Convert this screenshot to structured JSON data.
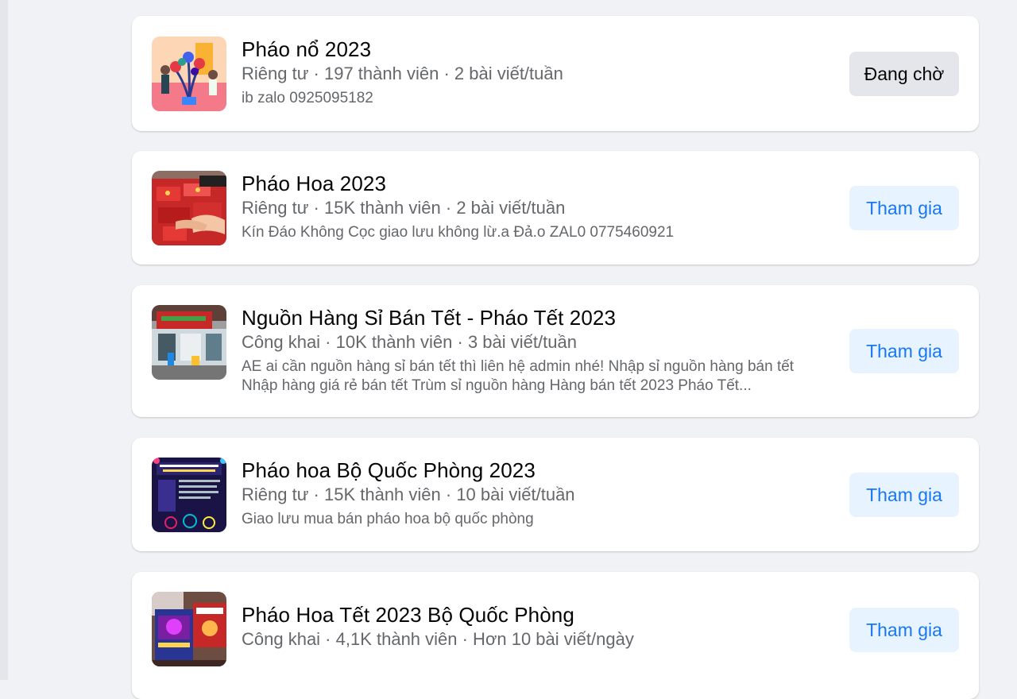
{
  "colors": {
    "page_background": "#f0f2f5",
    "card_background": "#ffffff",
    "primary_text": "#050505",
    "secondary_text": "#65676b",
    "join_button_bg": "#e7f3ff",
    "join_button_text": "#1877f2",
    "pending_button_bg": "#e4e6eb"
  },
  "groups": [
    {
      "name": "Pháo nổ 2023",
      "meta": "Riêng tư · 197 thành viên · 2 bài viết/tuần",
      "description": "ib zalo 0925095182",
      "button_label": "Đang chờ",
      "button_state": "pending",
      "thumbnail_icon": "flowers-illustration-image"
    },
    {
      "name": "Pháo Hoa 2023",
      "meta": "Riêng tư · 15K thành viên · 2 bài viết/tuần",
      "description": "Kín Đáo Không Cọc giao lưu không lừ.a Đả.o ZAL0 0775460921",
      "button_label": "Tham gia",
      "button_state": "join",
      "thumbnail_icon": "firework-boxes-photo"
    },
    {
      "name": "Nguồn Hàng Sỉ Bán Tết - Pháo Tết 2023",
      "meta": "Công khai · 10K thành viên · 3 bài viết/tuần",
      "description": "AE ai cần nguồn hàng sỉ bán tết thì liên hệ admin nhé! Nhập sỉ nguồn hàng bán tết Nhập hàng giá rẻ bán tết Trùm sỉ nguồn hàng Hàng bán tết 2023 Pháo Tết...",
      "button_label": "Tham gia",
      "button_state": "join",
      "thumbnail_icon": "storefront-photo"
    },
    {
      "name": "Pháo hoa Bộ Quốc Phòng 2023",
      "meta": "Riêng tư · 15K thành viên · 10 bài viết/tuần",
      "description": "Giao lưu mua bán pháo hoa bộ quốc phòng",
      "button_label": "Tham gia",
      "button_state": "join",
      "thumbnail_icon": "fireworks-infographic-image"
    },
    {
      "name": "Pháo Hoa Tết 2023 Bộ Quốc Phòng",
      "meta": "Công khai · 4,1K thành viên · Hơn 10 bài viết/ngày",
      "description": "",
      "button_label": "Tham gia",
      "button_state": "join",
      "thumbnail_icon": "firework-product-box-photo"
    }
  ]
}
